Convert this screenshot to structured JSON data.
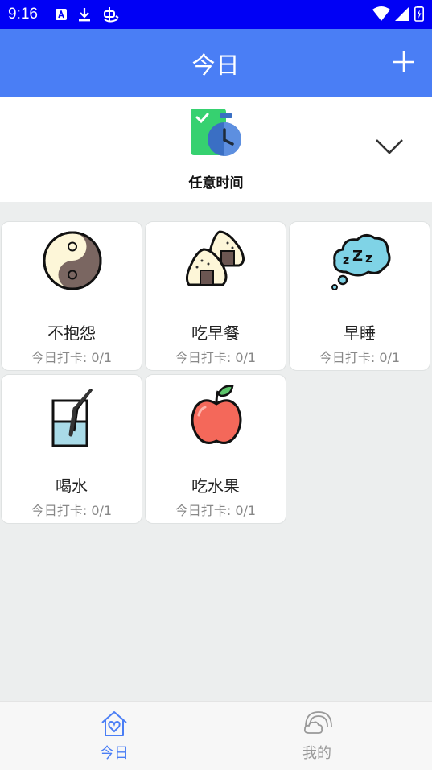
{
  "status_bar": {
    "time": "9:16"
  },
  "app_bar": {
    "title": "今日"
  },
  "filter": {
    "label": "任意时间"
  },
  "habits": [
    {
      "title": "不抱怨",
      "checkin": "今日打卡: 0/1",
      "icon": "yin-yang-icon"
    },
    {
      "title": "吃早餐",
      "checkin": "今日打卡: 0/1",
      "icon": "rice-ball-icon"
    },
    {
      "title": "早睡",
      "checkin": "今日打卡: 0/1",
      "icon": "sleep-cloud-icon"
    },
    {
      "title": "喝水",
      "checkin": "今日打卡: 0/1",
      "icon": "water-glass-icon"
    },
    {
      "title": "吃水果",
      "checkin": "今日打卡: 0/1",
      "icon": "apple-icon"
    }
  ],
  "bottom_nav": {
    "items": [
      {
        "label": "今日",
        "icon": "home-heart-icon",
        "active": true
      },
      {
        "label": "我的",
        "icon": "rainbow-cloud-icon",
        "active": false
      }
    ]
  },
  "colors": {
    "accent": "#4a7ef5",
    "status_bar": "#0000f5",
    "inactive": "#999999"
  }
}
